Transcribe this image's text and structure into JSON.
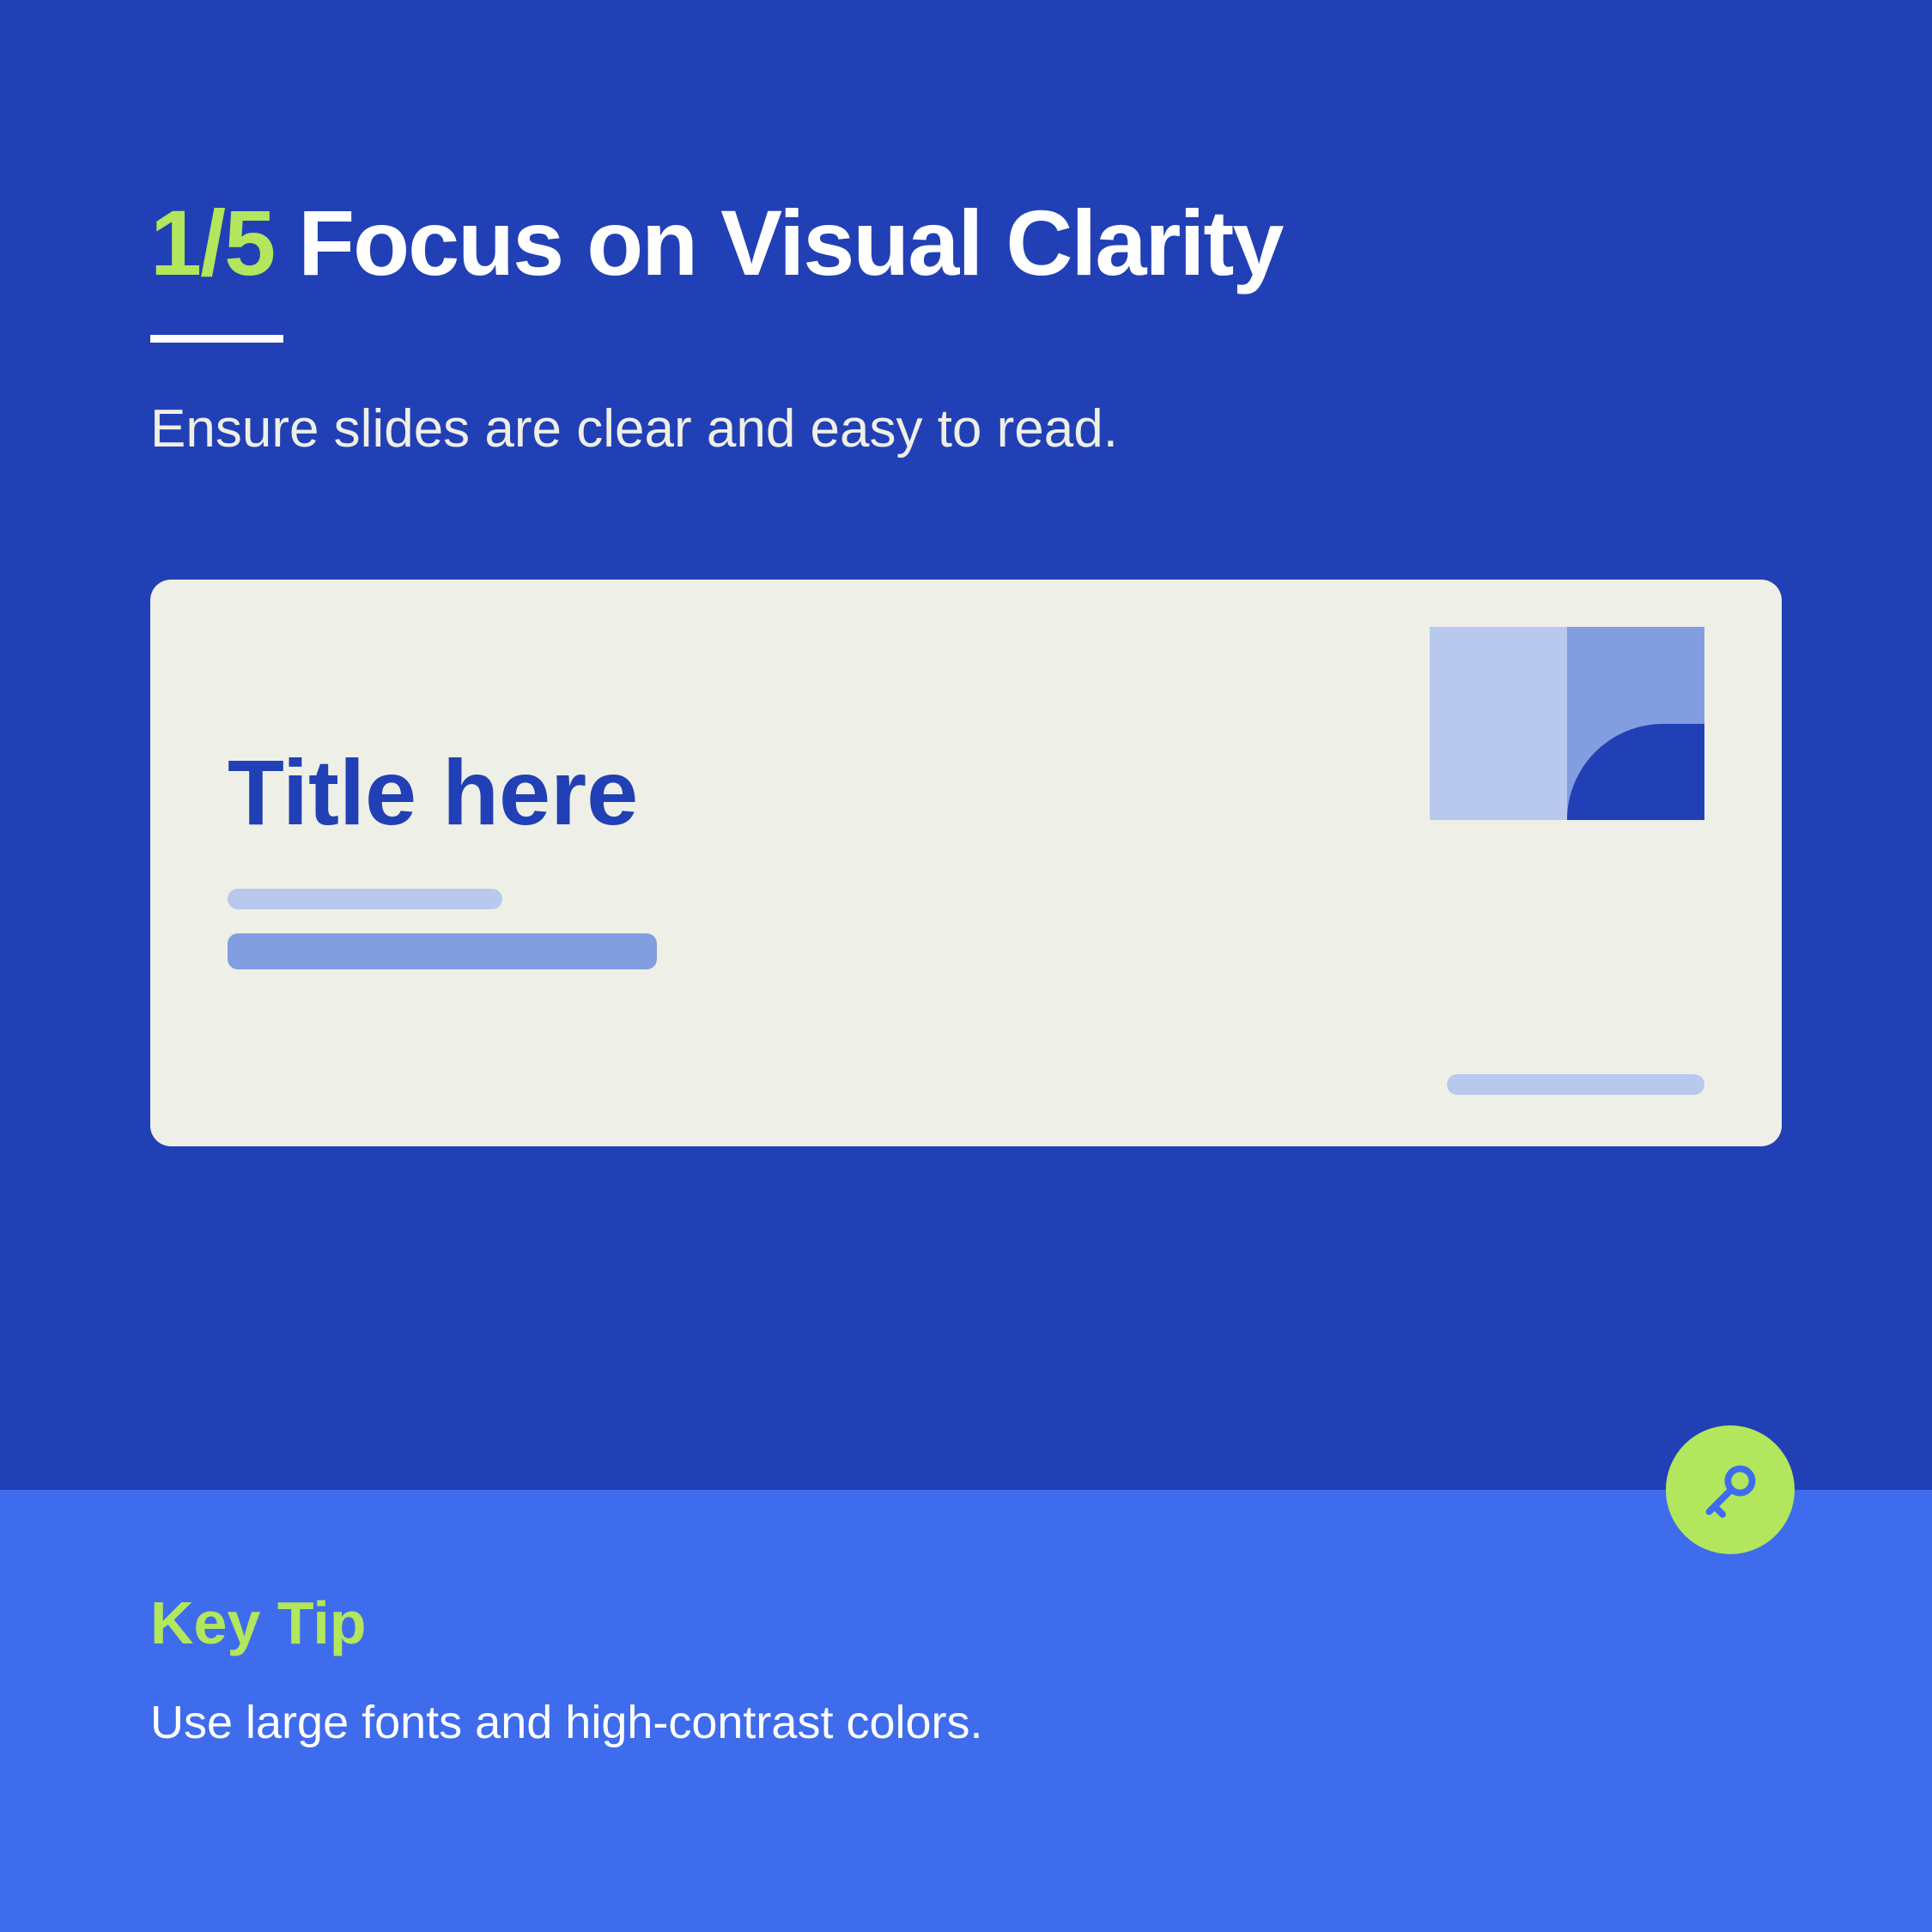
{
  "header": {
    "slide_number": "1/5",
    "title": "Focus on Visual Clarity",
    "subtitle": "Ensure slides are clear and easy to read."
  },
  "preview": {
    "title": "Title here"
  },
  "tip": {
    "label": "Key Tip",
    "text": "Use large fonts and high-contrast colors."
  },
  "colors": {
    "primary_bg": "#2240b5",
    "secondary_bg": "#3e6cec",
    "accent": "#b2e65c",
    "cream": "#eef0e7",
    "light_blue": "#b9c8ed",
    "mid_blue": "#839ee0"
  }
}
